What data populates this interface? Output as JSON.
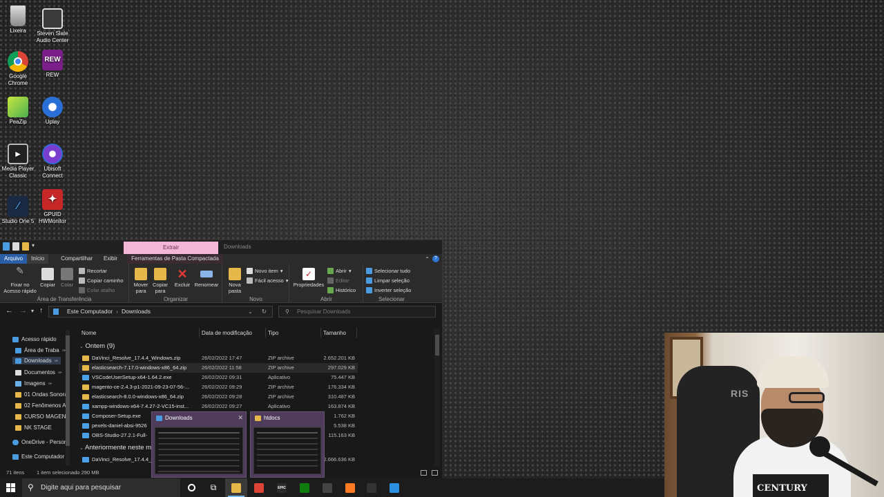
{
  "desktop": {
    "icons": [
      {
        "label": "Lixeira",
        "icon": "recycle-bin-icon"
      },
      {
        "label": "Steven Slate Audio Center",
        "icon": "steven-slate-icon"
      },
      {
        "label": "Google Chrome",
        "icon": "chrome-icon"
      },
      {
        "label": "REW",
        "icon": "rew-icon",
        "glyph": "REW"
      },
      {
        "label": "PeaZip",
        "icon": "peazip-icon"
      },
      {
        "label": "Uplay",
        "icon": "uplay-icon"
      },
      {
        "label": "Media Player Classic",
        "icon": "mpc-icon"
      },
      {
        "label": "Ubisoft Connect",
        "icon": "ubisoft-icon"
      },
      {
        "label": "Studio One 5",
        "icon": "studio-one-icon"
      },
      {
        "label": "GPUID HWMonitor",
        "icon": "hwmonitor-icon"
      }
    ]
  },
  "explorer": {
    "title_tab": "Extrair",
    "window_title": "Downloads",
    "ribbon_tabs": [
      "Arquivo",
      "Início",
      "Compartilhar",
      "Exibir",
      "Ferramentas de Pasta Compactada"
    ],
    "ribbon": {
      "clipboard": {
        "pin": "Fixar no Acesso rápido",
        "copy": "Copiar",
        "paste": "Colar",
        "cut": "Recortar",
        "copy_path": "Copiar caminho",
        "paste_shortcut": "Colar atalho",
        "label": "Área de Transferência"
      },
      "organize": {
        "move": "Mover para",
        "copy_to": "Copiar para",
        "delete": "Excluir",
        "rename": "Renomear",
        "label": "Organizar"
      },
      "new": {
        "new_folder": "Nova pasta",
        "new_item": "Novo item",
        "easy_access": "Fácil acesso",
        "label": "Novo"
      },
      "open": {
        "properties": "Propriedades",
        "open": "Abrir",
        "edit": "Editar",
        "history": "Histórico",
        "label": "Abrir"
      },
      "select": {
        "select_all": "Selecionar tudo",
        "clear_selection": "Limpar seleção",
        "invert_selection": "Inverter seleção",
        "label": "Selecionar"
      }
    },
    "address": {
      "crumbs": [
        "Este Computador",
        "Downloads"
      ],
      "search_placeholder": "Pesquisar Downloads"
    },
    "nav": [
      {
        "label": "Acesso rápido",
        "pinned": false
      },
      {
        "label": "Área de Traba",
        "pinned": true
      },
      {
        "label": "Downloads",
        "pinned": true
      },
      {
        "label": "Documentos",
        "pinned": true
      },
      {
        "label": "Imagens",
        "pinned": true
      },
      {
        "label": "01 Ondas Sonora",
        "pinned": false
      },
      {
        "label": "02 Fenômenos A",
        "pinned": false
      },
      {
        "label": "CURSO MAGENT",
        "pinned": false
      },
      {
        "label": "NK STAGE",
        "pinned": false
      },
      {
        "label": "OneDrive - Person",
        "pinned": false
      },
      {
        "label": "Este Computador",
        "pinned": false
      }
    ],
    "columns": [
      "Nome",
      "Data de modificação",
      "Tipo",
      "Tamanho"
    ],
    "group_today": "Ontem (9)",
    "group_earlier": "Anteriormente neste m",
    "files": [
      {
        "name": "DaVinci_Resolve_17.4.4_Windows.zip",
        "date": "26/02/2022 17:47",
        "type": "ZIP archive",
        "size": "2.652.201 KB",
        "kind": "zip"
      },
      {
        "name": "elasticsearch-7.17.0-windows-x86_64.zip",
        "date": "26/02/2022 11:58",
        "type": "ZIP archive",
        "size": "297.029 KB",
        "kind": "zip"
      },
      {
        "name": "VSCodeUserSetup-x64-1.64.2.exe",
        "date": "26/02/2022 09:31",
        "type": "Aplicativo",
        "size": "75.447 KB",
        "kind": "exe"
      },
      {
        "name": "magento-ce-2.4.3-p1-2021-09-23-07-56-...",
        "date": "26/02/2022 09:29",
        "type": "ZIP archive",
        "size": "176.334 KB",
        "kind": "zip"
      },
      {
        "name": "elasticsearch-8.0.0-windows-x86_64.zip",
        "date": "26/02/2022 09:28",
        "type": "ZIP archive",
        "size": "310.487 KB",
        "kind": "zip"
      },
      {
        "name": "xampp-windows-x64-7.4.27-2-VC15-inst...",
        "date": "26/02/2022 09:27",
        "type": "Aplicativo",
        "size": "163.874 KB",
        "kind": "exe"
      },
      {
        "name": "Composer-Setup.exe",
        "date": "",
        "type": "",
        "size": "1.762 KB",
        "kind": "exe"
      },
      {
        "name": "pexels-daniel-absi-9526",
        "date": "",
        "type": "",
        "size": "5.538 KB",
        "kind": "exe"
      },
      {
        "name": "OBS-Studio-27.2.1-Full-",
        "date": "",
        "type": "",
        "size": "115.163 KB",
        "kind": "exe"
      }
    ],
    "earlier_files": [
      {
        "name": "DaVinci_Resolve_17.4.4_",
        "date": "",
        "type": "",
        "size": "2.666.636 KB",
        "kind": "zip"
      }
    ],
    "status": {
      "count": "71 itens",
      "selection": "1 item selecionado  290 MB"
    }
  },
  "thumbnails": [
    {
      "title": "Downloads"
    },
    {
      "title": "htdocs"
    }
  ],
  "webcam": {
    "chair_text": "RIS",
    "shirt_text": "CENTURY"
  },
  "taskbar": {
    "search_placeholder": "Digite aqui para pesquisar",
    "apps": [
      {
        "name": "file-explorer-icon",
        "color": "#e6b84a",
        "active": true
      },
      {
        "name": "chrome-icon",
        "color": "#db4437",
        "active": false
      },
      {
        "name": "epic-games-icon",
        "color": "#2a2a2a",
        "glyph": "EPIC",
        "active": false
      },
      {
        "name": "xbox-icon",
        "color": "#107c10",
        "active": false
      },
      {
        "name": "obs-icon",
        "color": "#444444",
        "active": false
      },
      {
        "name": "xampp-icon",
        "color": "#fb7a24",
        "active": false
      },
      {
        "name": "terminal-icon",
        "color": "#333333",
        "active": false
      },
      {
        "name": "vscode-icon",
        "color": "#2d8fe0",
        "active": false
      }
    ]
  },
  "colors": {
    "accent": "#2a5fa8",
    "context_tab": "#f4b6d6",
    "folder": "#e6b84a"
  }
}
